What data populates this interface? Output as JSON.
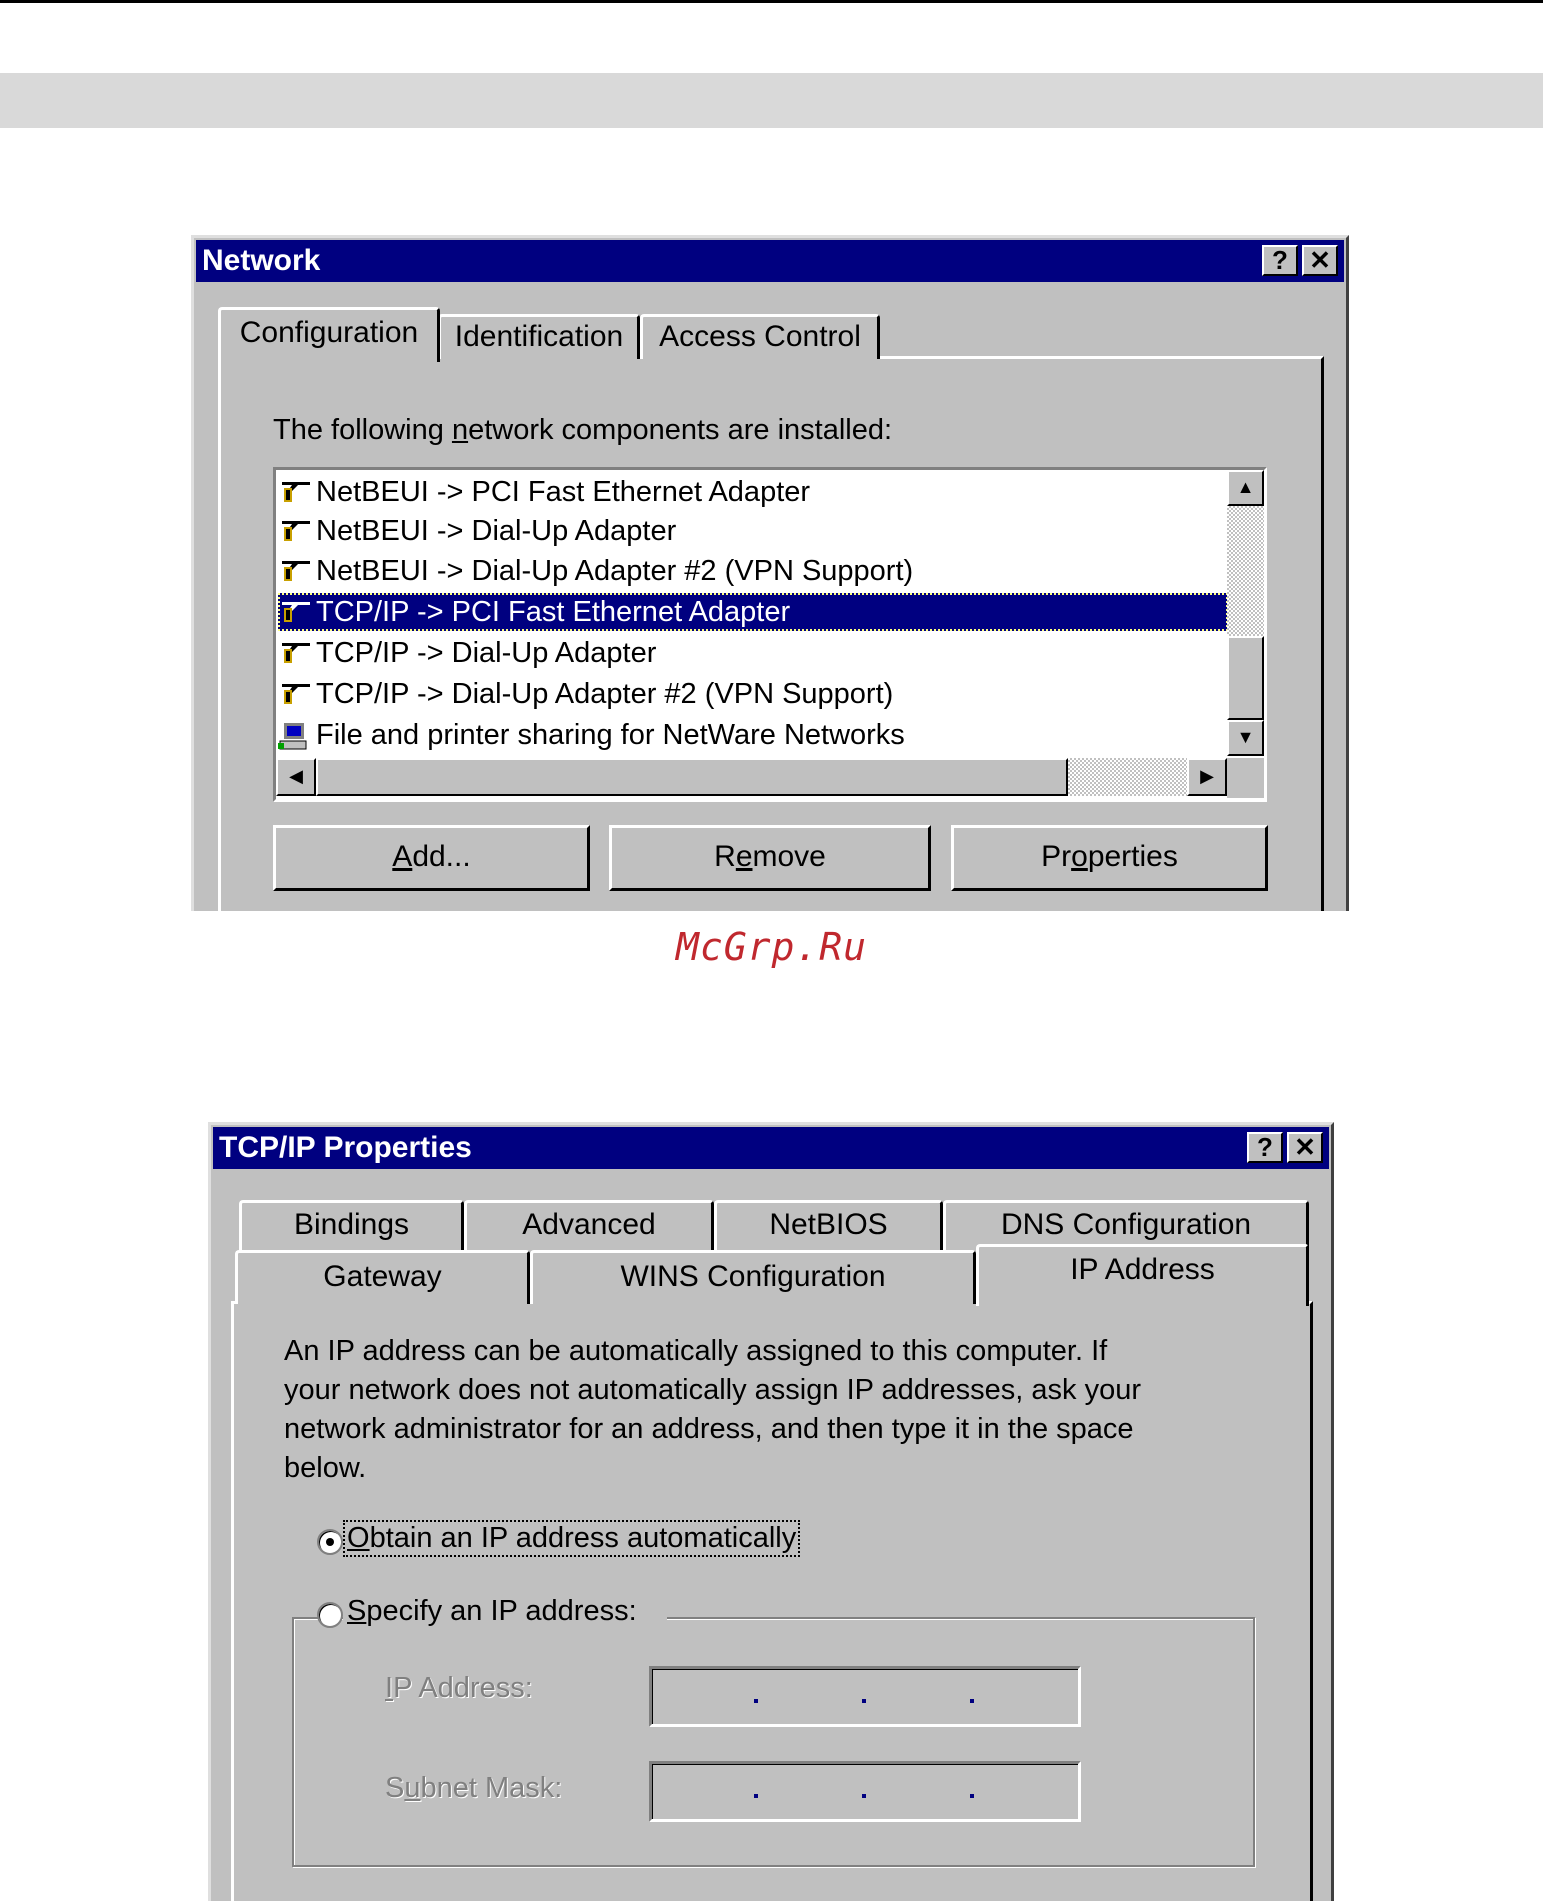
{
  "network_dialog": {
    "title": "Network",
    "help_button": "?",
    "close_button": "✕",
    "tabs": [
      "Configuration",
      "Identification",
      "Access Control"
    ],
    "components_label": "The following network components are installed:",
    "components_label_pre": "The following ",
    "components_label_u": "n",
    "components_label_post": "etwork components are installed:",
    "components": [
      {
        "label": "NetBEUI -> PCI Fast Ethernet Adapter",
        "icon": "network-protocol-icon",
        "selected": false
      },
      {
        "label": "NetBEUI -> Dial-Up Adapter",
        "icon": "network-protocol-icon",
        "selected": false
      },
      {
        "label": "NetBEUI -> Dial-Up Adapter #2 (VPN Support)",
        "icon": "network-protocol-icon",
        "selected": false
      },
      {
        "label": "TCP/IP -> PCI Fast Ethernet Adapter",
        "icon": "network-protocol-icon",
        "selected": true
      },
      {
        "label": "TCP/IP -> Dial-Up Adapter",
        "icon": "network-protocol-icon",
        "selected": false
      },
      {
        "label": "TCP/IP -> Dial-Up Adapter #2 (VPN Support)",
        "icon": "network-protocol-icon",
        "selected": false
      },
      {
        "label": "File and printer sharing for NetWare Networks",
        "icon": "file-printer-sharing-icon",
        "selected": false
      }
    ],
    "buttons": {
      "add": {
        "u": "A",
        "rest": "dd..."
      },
      "remove": {
        "pre": "R",
        "u": "e",
        "rest": "move"
      },
      "properties": {
        "pre": "Pr",
        "u": "o",
        "rest": "perties"
      }
    }
  },
  "watermark": "McGrp.Ru",
  "tcpip_dialog": {
    "title": "TCP/IP Properties",
    "help_button": "?",
    "close_button": "✕",
    "tabs_back_row": [
      "Bindings",
      "Advanced",
      "NetBIOS",
      "DNS Configuration"
    ],
    "tabs_front_row": [
      "Gateway",
      "WINS Configuration",
      "IP Address"
    ],
    "active_tab": "IP Address",
    "description_lines": [
      "An IP address can be automatically assigned to this computer.  If",
      "your network does not automatically assign IP addresses, ask your",
      "network administrator for an address, and then type it in the space",
      "below."
    ],
    "radio_obtain": {
      "u": "O",
      "rest": "btain an IP address automatically",
      "checked": true
    },
    "radio_specify": {
      "u": "S",
      "rest": "pecify an IP address:",
      "checked": false
    },
    "ip_address_label": {
      "u": "I",
      "rest": "P Address:"
    },
    "subnet_mask_label": {
      "pre": "S",
      "u": "u",
      "rest": "bnet Mask:"
    },
    "ip_address_value": ". . .",
    "subnet_mask_value": ". . ."
  }
}
